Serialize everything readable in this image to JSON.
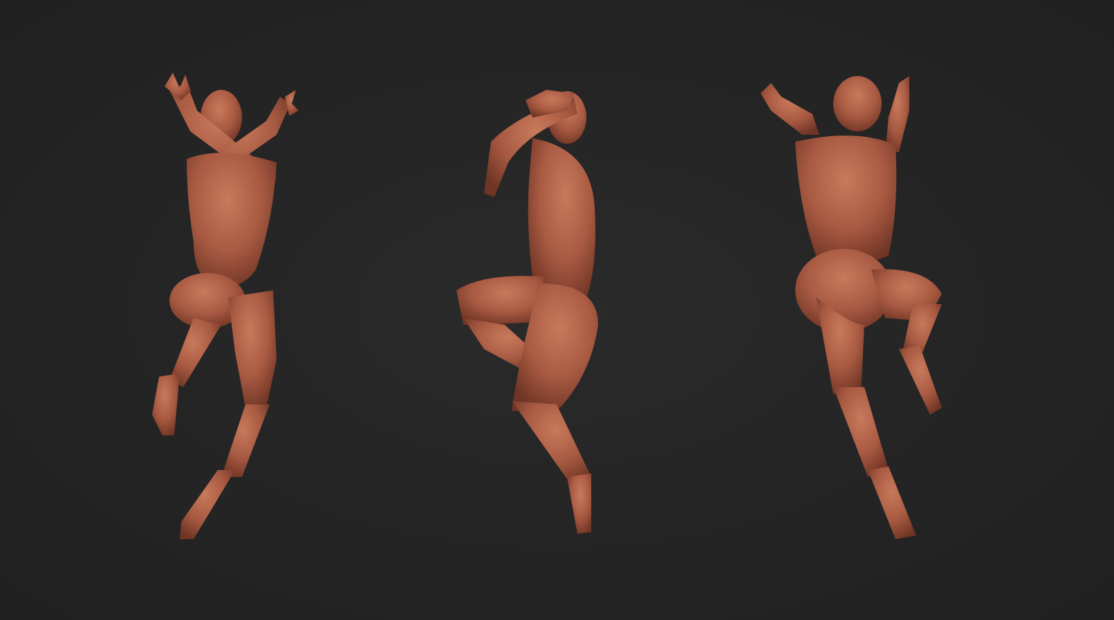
{
  "scene": {
    "background_color": "#242424",
    "material_color": "#a85a42",
    "material_highlight": "#c97a5c",
    "material_shadow": "#6e3424"
  },
  "figures": [
    {
      "id": "front",
      "view": "front"
    },
    {
      "id": "side",
      "view": "side"
    },
    {
      "id": "back",
      "view": "back"
    }
  ]
}
